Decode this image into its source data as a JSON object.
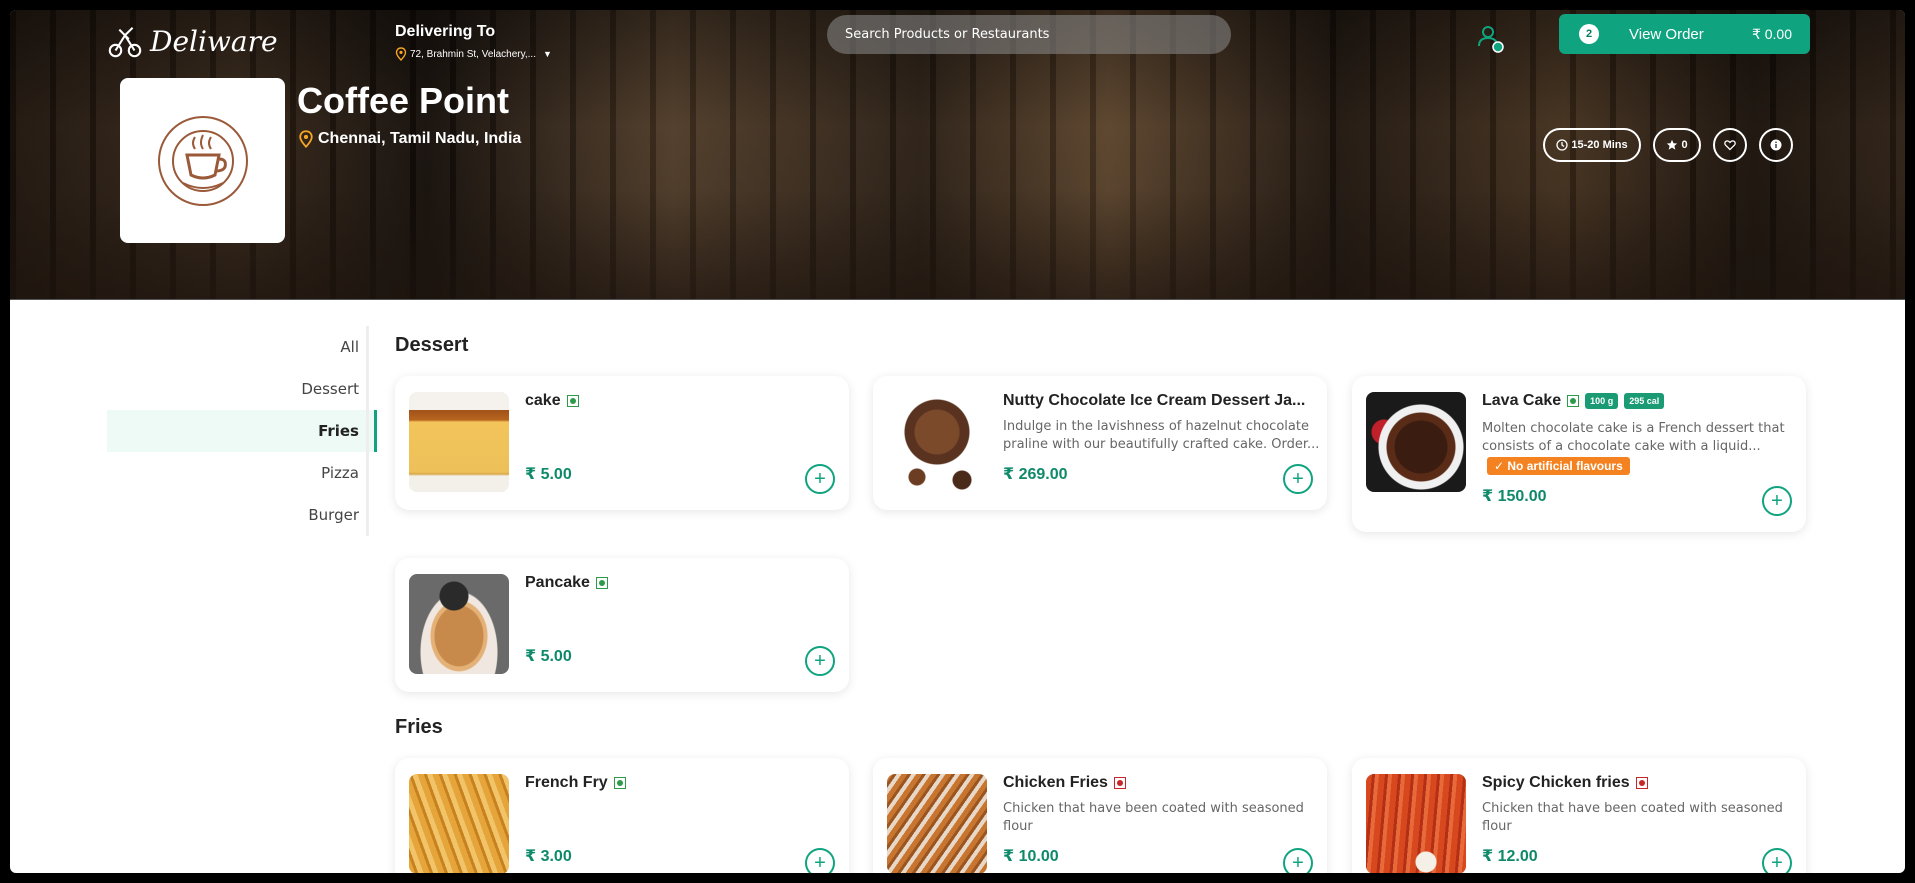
{
  "header": {
    "brand": "Deliware",
    "delivering_label": "Delivering To",
    "address": "72, Brahmin St, Velachery,...",
    "search_placeholder": "Search Products or Restaurants",
    "order": {
      "count": "2",
      "label": "View Order",
      "total": "₹ 0.00"
    }
  },
  "restaurant": {
    "name": "Coffee Point",
    "location": "Chennai, Tamil Nadu, India",
    "delivery_time": "15-20 Mins",
    "rating": "0"
  },
  "categories": [
    {
      "label": "All"
    },
    {
      "label": "Dessert"
    },
    {
      "label": "Fries",
      "active": true
    },
    {
      "label": "Pizza"
    },
    {
      "label": "Burger"
    }
  ],
  "sections": [
    {
      "title": "Dessert",
      "items": [
        {
          "name": "cake",
          "diet": "veg",
          "price": "₹ 5.00",
          "description": ""
        },
        {
          "name": "Nutty Chocolate Ice Cream Dessert Ja...",
          "diet": "none",
          "price": "₹ 269.00",
          "description": "Indulge in the lavishness of hazelnut chocolate praline with our beautifully crafted cake. Order..."
        },
        {
          "name": "Lava Cake",
          "diet": "veg",
          "price": "₹ 150.00",
          "description": "Molten chocolate cake is a French dessert that consists of a chocolate cake with a liquid...",
          "tags": [
            "100 g",
            "295 cal"
          ],
          "badge": "No artificial flavours"
        },
        {
          "name": "Pancake",
          "diet": "veg",
          "price": "₹ 5.00",
          "description": ""
        }
      ]
    },
    {
      "title": "Fries",
      "items": [
        {
          "name": "French Fry",
          "diet": "veg",
          "price": "₹ 3.00",
          "description": ""
        },
        {
          "name": "Chicken Fries",
          "diet": "nonveg",
          "price": "₹ 10.00",
          "description": "Chicken that have been coated with seasoned flour"
        },
        {
          "name": "Spicy Chicken fries",
          "diet": "nonveg",
          "price": "₹ 12.00",
          "description": "Chicken that have been coated with seasoned flour"
        }
      ]
    }
  ],
  "add_symbol": "+",
  "colors": {
    "accent": "#10a37f",
    "price": "#0e8a6a",
    "badge": "#f58220",
    "veg": "#2e9b4b",
    "nonveg": "#c62828"
  }
}
